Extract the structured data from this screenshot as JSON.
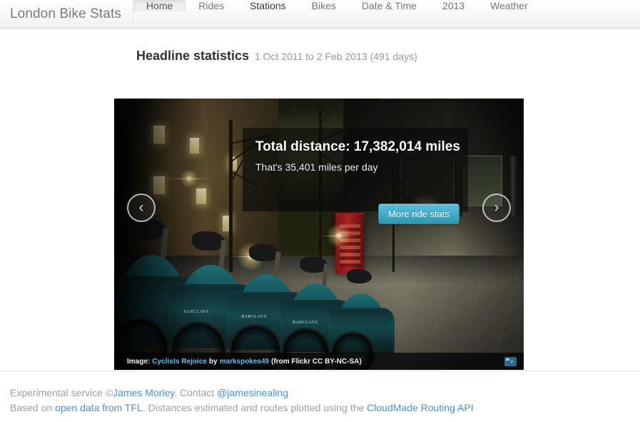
{
  "navbar": {
    "brand": "London Bike Stats",
    "items": [
      {
        "label": "Home",
        "state": "active"
      },
      {
        "label": "Rides",
        "state": "normal"
      },
      {
        "label": "Stations",
        "state": "strong"
      },
      {
        "label": "Bikes",
        "state": "normal"
      },
      {
        "label": "Date & Time",
        "state": "normal"
      },
      {
        "label": "2013",
        "state": "normal"
      },
      {
        "label": "Weather",
        "state": "normal"
      }
    ]
  },
  "headline": {
    "title": "Headline statistics",
    "subtitle": "1 Oct 2011 to 2 Feb 2013 (491 days)"
  },
  "carousel": {
    "prev_glyph": "‹",
    "next_glyph": "›",
    "stats": {
      "title": "Total distance: 17,382,014 miles",
      "subtitle": "That's 35,401 miles per day",
      "button_label": "More ride stats",
      "button_color": "#5bc0de"
    },
    "caption": {
      "prefix": "Image:",
      "photo_title": "Cyclists Rejoice",
      "by": "by",
      "author": "markspokes49",
      "license": "(from Flickr CC BY-NC-SA)",
      "link_color": "#6fb8e8"
    }
  },
  "footer": {
    "line1": {
      "part1": "Experimental service ©",
      "link1": "James Morley",
      "part2": ". Contact ",
      "link2": "@jamesinealing"
    },
    "line2": {
      "part1": "Based on ",
      "link1": "open data from TFL",
      "part2": ". Distances estimated and routes plotted using the ",
      "link2": "CloudMade Routing API"
    },
    "link_color": "#4a90d9"
  }
}
